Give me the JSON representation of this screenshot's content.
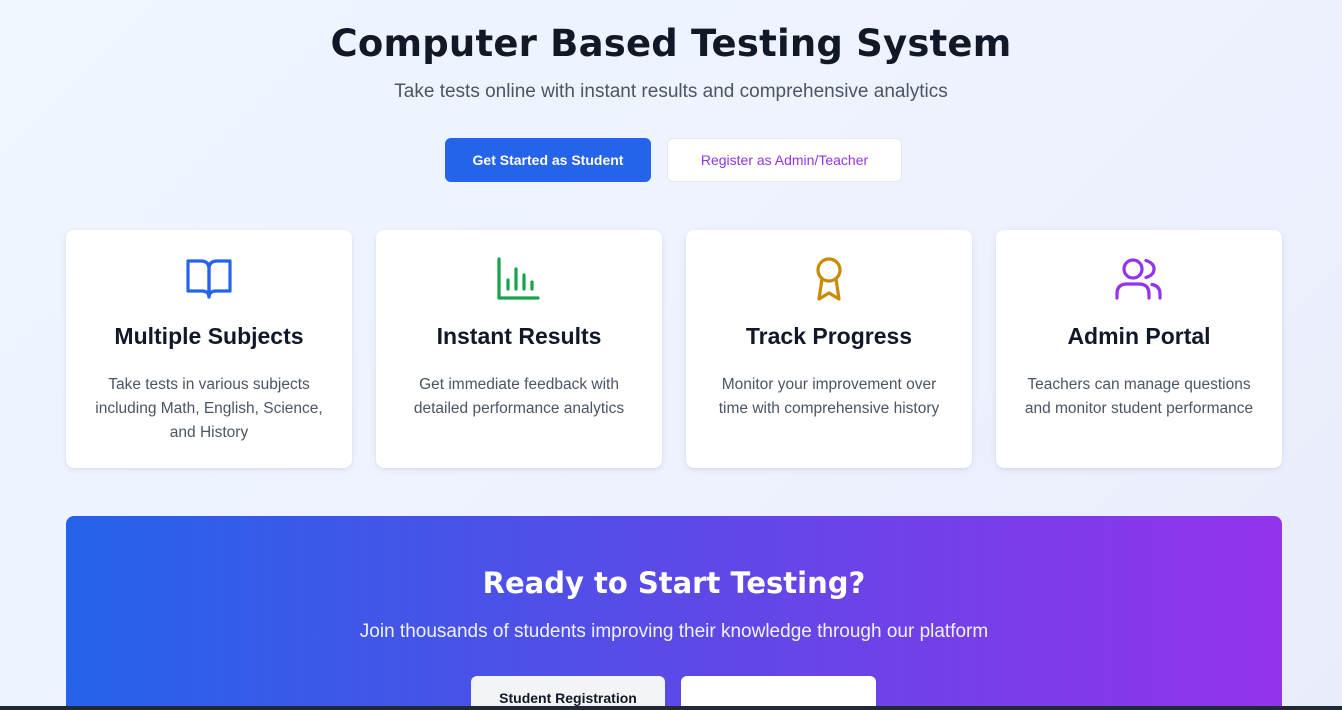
{
  "hero": {
    "title": "Computer Based Testing System",
    "subtitle": "Take tests online with instant results and comprehensive analytics",
    "primary_button": "Get Started as Student",
    "secondary_button": "Register as Admin/Teacher"
  },
  "features": [
    {
      "icon": "book-open-icon",
      "color": "#2563eb",
      "title": "Multiple Subjects",
      "description": "Take tests in various subjects including Math, English, Science, and History"
    },
    {
      "icon": "bar-chart-icon",
      "color": "#16a34a",
      "title": "Instant Results",
      "description": "Get immediate feedback with detailed performance analytics"
    },
    {
      "icon": "award-icon",
      "color": "#ca8a04",
      "title": "Track Progress",
      "description": "Monitor your improvement over time with comprehensive history"
    },
    {
      "icon": "users-icon",
      "color": "#9333ea",
      "title": "Admin Portal",
      "description": "Teachers can manage questions and monitor student performance"
    }
  ],
  "cta": {
    "title": "Ready to Start Testing?",
    "subtitle": "Join thousands of students improving their knowledge through our platform",
    "button_student": "Student Registration",
    "button_second": ""
  },
  "colors": {
    "primary": "#2563eb",
    "accent": "#9333ea"
  }
}
